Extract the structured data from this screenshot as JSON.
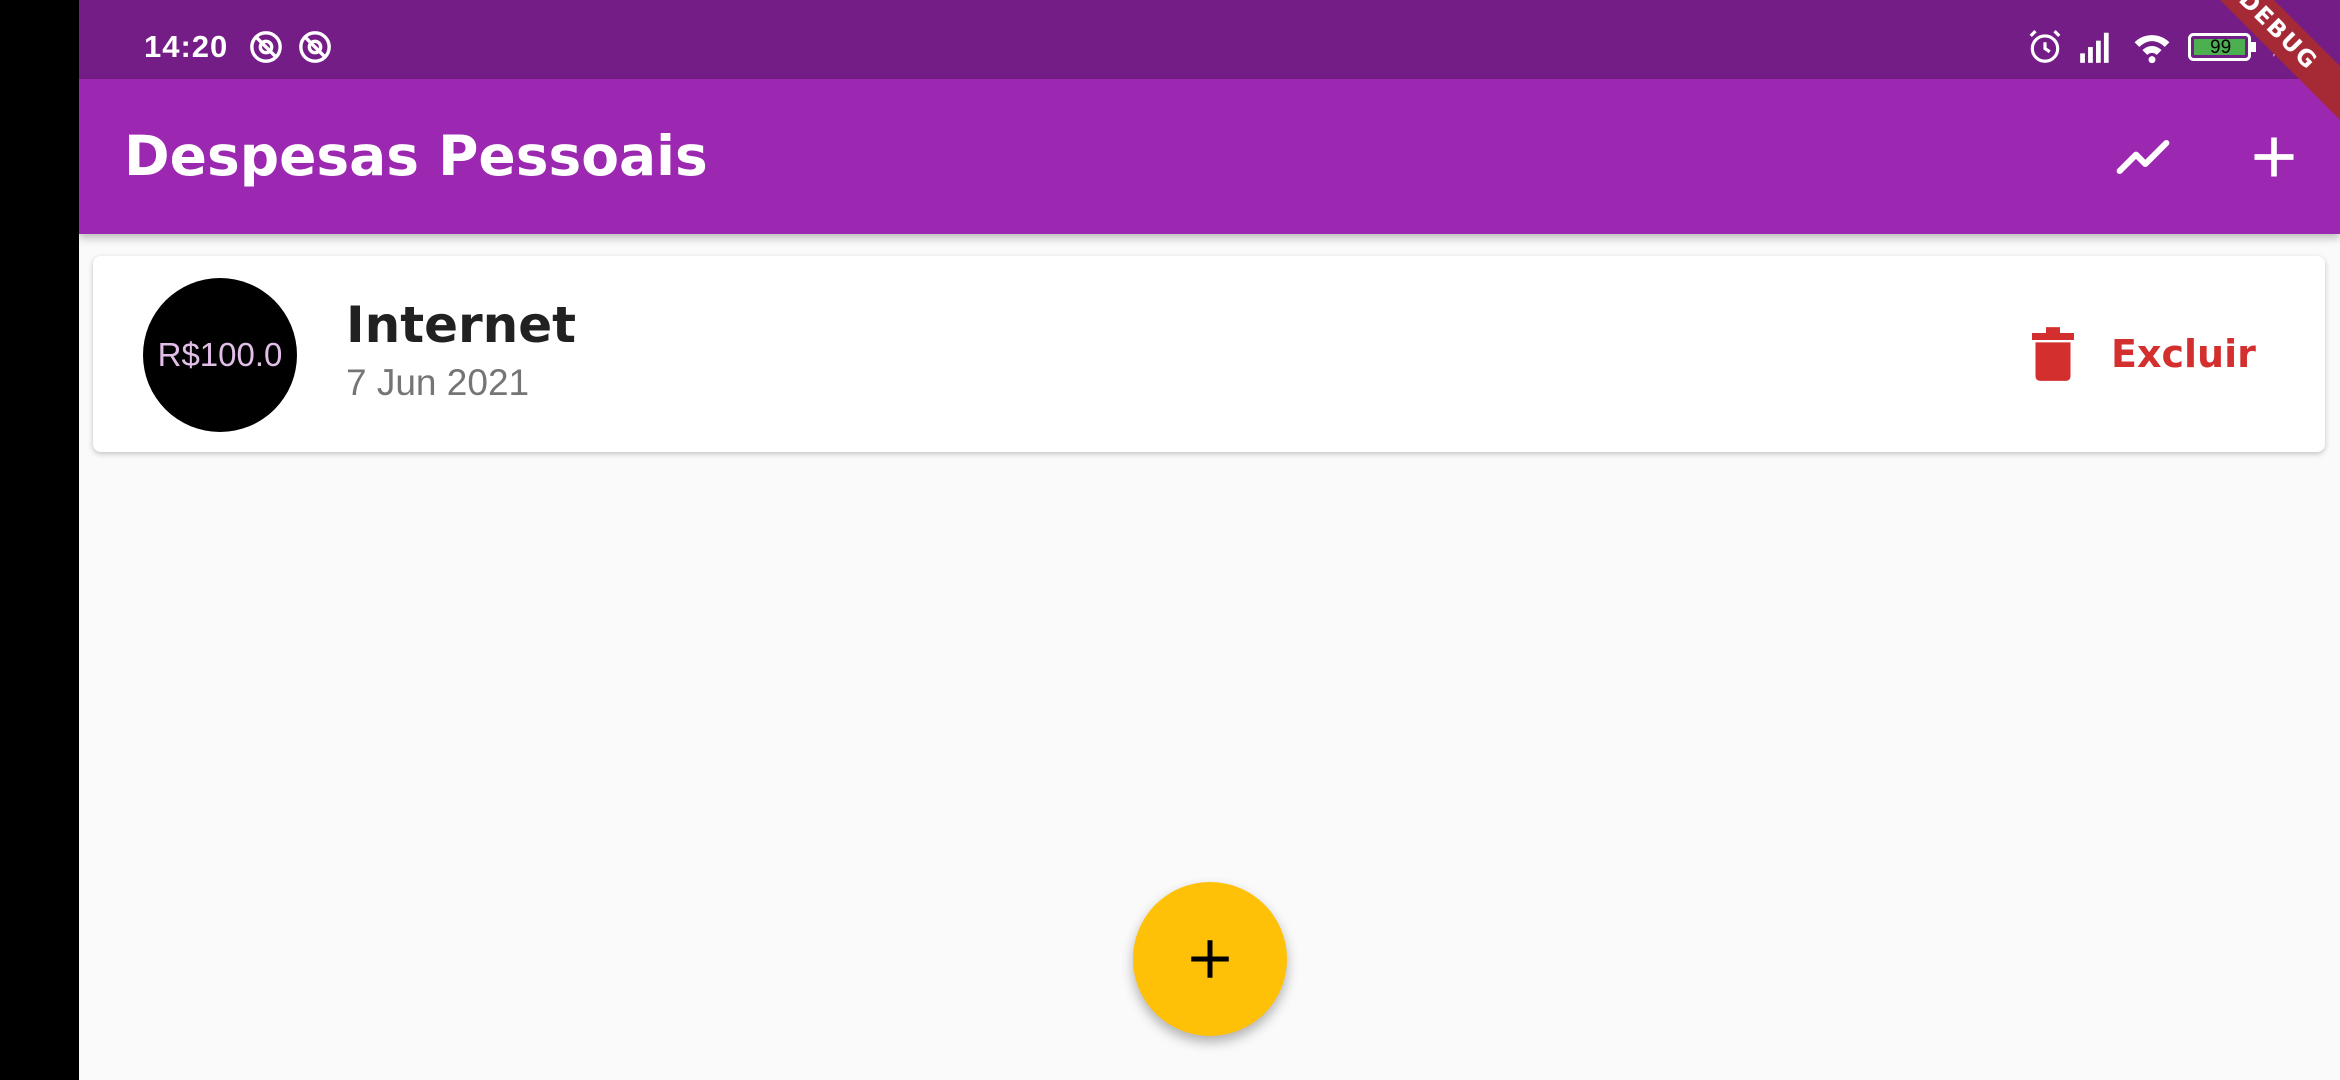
{
  "status_bar": {
    "time": "14:20",
    "battery_level": "99",
    "left_icons": [
      "at-sign-icon",
      "at-sign-icon"
    ],
    "right_icons": [
      "alarm-icon",
      "signal-icon",
      "wifi-icon",
      "battery-icon",
      "charging-icon"
    ]
  },
  "debug_banner": {
    "label": "DEBUG"
  },
  "app_bar": {
    "title": "Despesas Pessoais",
    "actions": [
      "show-chart-icon",
      "add-icon"
    ]
  },
  "transactions": [
    {
      "amount": "R$100.0",
      "title": "Internet",
      "date": "7 Jun 2021",
      "delete_label": "Excluir"
    }
  ],
  "fab": {
    "icon": "add-icon"
  },
  "colors": {
    "status_bar": "#751d87",
    "app_bar": "#9c27b0",
    "background": "#fafafa",
    "avatar": "#000000",
    "avatar_text": "#e1bee7",
    "delete": "#d32f2f",
    "fab": "#ffc107",
    "debug_banner": "#a52a36"
  }
}
